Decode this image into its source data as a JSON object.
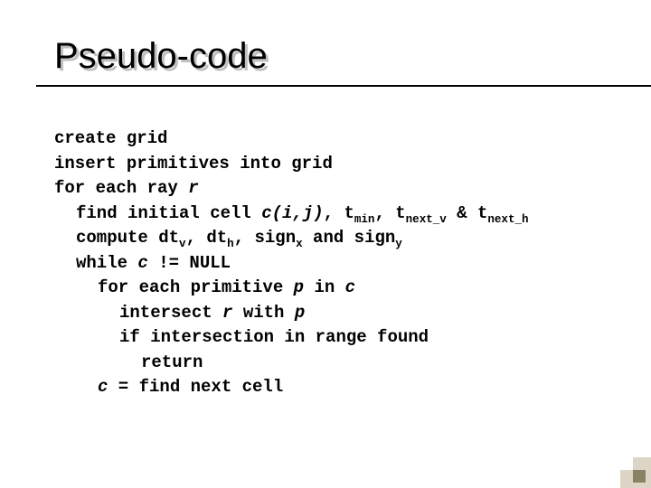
{
  "title": "Pseudo-code",
  "code": {
    "l0": "create grid",
    "l1": "insert primitives into grid",
    "l2_a": "for each ray ",
    "l2_r": "r",
    "l3_a": "find initial cell ",
    "l3_c": "c(i,j)",
    "l3_b": ", t",
    "l3_sub1": "min",
    "l3_c2": ", t",
    "l3_sub2": "next_v",
    "l3_d": " & t",
    "l3_sub3": "next_h",
    "l4_a": "compute dt",
    "l4_sub1": "v",
    "l4_b": ", dt",
    "l4_sub2": "h",
    "l4_c": ", sign",
    "l4_sub3": "x",
    "l4_d": " and sign",
    "l4_sub4": "y",
    "l5_a": "while ",
    "l5_c": "c",
    "l5_b": " != NULL",
    "l6_a": "for each primitive ",
    "l6_p": "p",
    "l6_b": " in ",
    "l6_c": "c",
    "l7_a": "intersect ",
    "l7_r": "r",
    "l7_b": " with ",
    "l7_p": "p",
    "l8": "if intersection in range found",
    "l9": "return",
    "l10_c": "c",
    "l10_a": " = find next cell"
  }
}
